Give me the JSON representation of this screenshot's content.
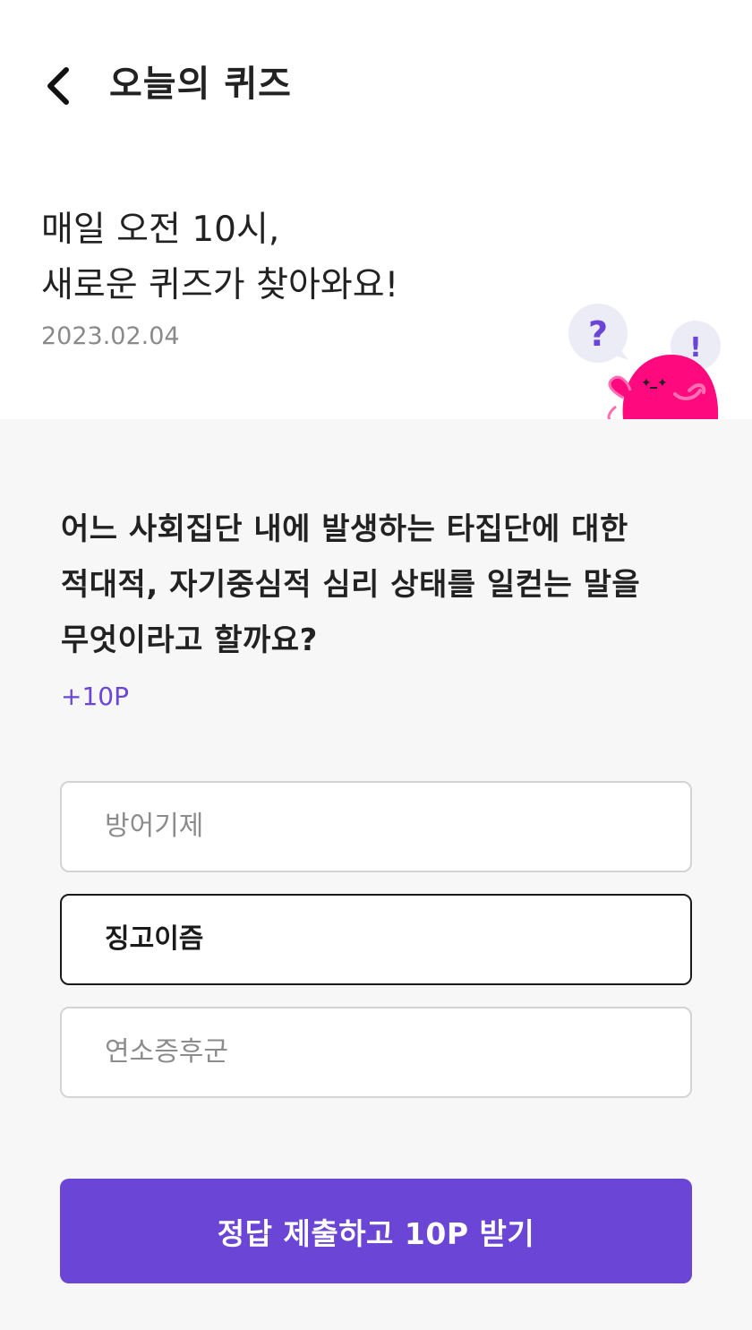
{
  "header": {
    "title": "오늘의 퀴즈",
    "back_icon": "chevron-left-icon"
  },
  "intro": {
    "line1": "매일 오전 10시,",
    "line2": "새로운 퀴즈가 찾아와요!",
    "date": "2023.02.04"
  },
  "mascot": {
    "question_mark": "?",
    "exclamation_mark": "!",
    "body_color": "#ff0a7e",
    "bubble_color": "#ececf7",
    "accent_color": "#6b45d6"
  },
  "quiz": {
    "question_lines": [
      "어느 사회집단 내에 발생하는 타집단에 대한",
      "적대적, 자기중심적 심리 상태를 일컫는 말을",
      "무엇이라고 할까요?"
    ],
    "points": "+10P",
    "options": [
      {
        "label": "방어기제",
        "selected": false
      },
      {
        "label": "징고이즘",
        "selected": true
      },
      {
        "label": "연소증후군",
        "selected": false
      }
    ],
    "submit_label": "정답 제출하고 10P 받기"
  },
  "colors": {
    "accent": "#6b45d6",
    "background": "#f7f7f7",
    "surface": "#ffffff"
  }
}
